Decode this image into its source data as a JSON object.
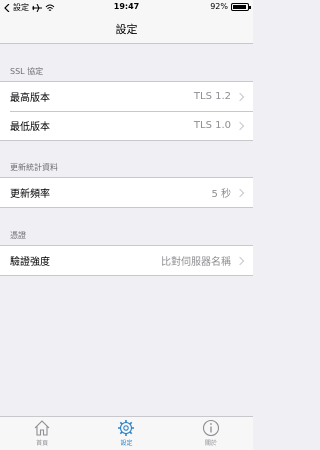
{
  "status_bar": {
    "back_label": "設定",
    "time": "19:47",
    "battery": "92%",
    "battery_level": 0.92
  },
  "nav": {
    "title": "設定"
  },
  "sections": [
    {
      "header": "SSL 協定",
      "rows": [
        {
          "label": "最高版本",
          "value": "TLS 1.2"
        },
        {
          "label": "最低版本",
          "value": "TLS 1.0"
        }
      ]
    },
    {
      "header": "更新統計資料",
      "rows": [
        {
          "label": "更新頻率",
          "value": "5 秒"
        }
      ]
    },
    {
      "header": "憑證",
      "rows": [
        {
          "label": "驗證強度",
          "value": "比對伺服器名稱"
        }
      ]
    }
  ],
  "tab_bar": {
    "tabs": [
      {
        "label": "首頁",
        "icon": "home-icon"
      },
      {
        "label": "設定",
        "icon": "gear-icon"
      },
      {
        "label": "關於",
        "icon": "info-icon"
      }
    ],
    "active_color": "#2e83c6",
    "inactive_color": "#8e8e93"
  }
}
